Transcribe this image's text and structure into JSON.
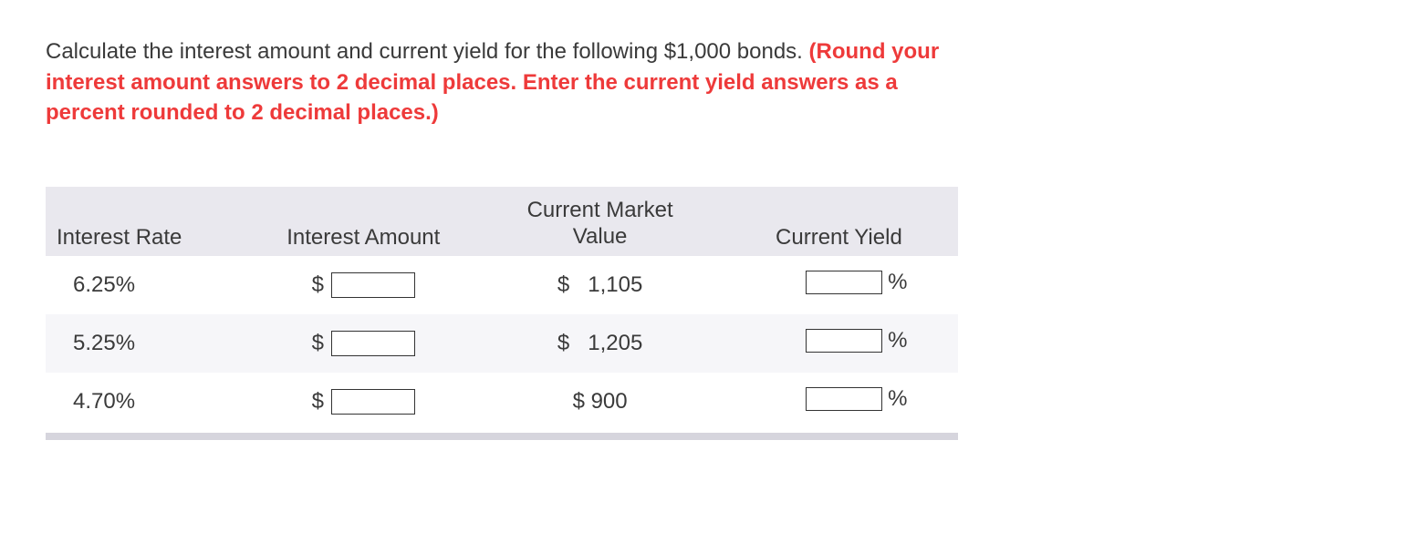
{
  "prompt": {
    "lead": "Calculate the interest amount and current yield for the following $1,000 bonds. ",
    "instruction": "(Round your interest amount answers to 2 decimal places. Enter the current yield answers as a percent rounded to 2 decimal places.)"
  },
  "table": {
    "headers": {
      "rate": "Interest Rate",
      "amount": "Interest Amount",
      "market": "Current Market Value",
      "yield": "Current Yield"
    },
    "symbols": {
      "dollar": "$",
      "percent": "%"
    },
    "rows": [
      {
        "rate": "6.25%",
        "amount": "",
        "market": "1,105",
        "yield": ""
      },
      {
        "rate": "5.25%",
        "amount": "",
        "market": "1,205",
        "yield": ""
      },
      {
        "rate": "4.70%",
        "amount": "",
        "market_inline": "$ 900",
        "yield": ""
      }
    ]
  }
}
